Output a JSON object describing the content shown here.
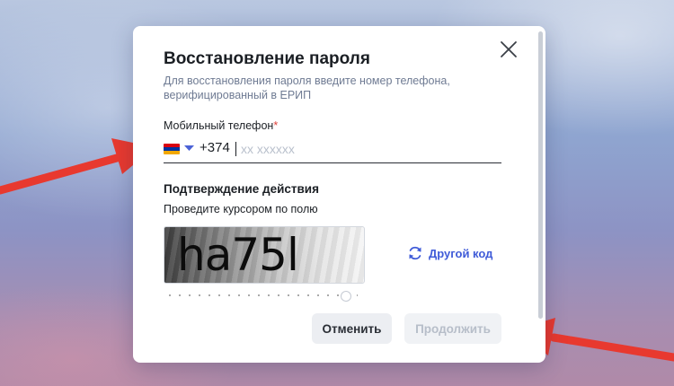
{
  "dialog": {
    "title": "Восстановление пароля",
    "subtitle": "Для восстановления пароля введите номер телефона, верифицированный в ЕРИП"
  },
  "phone": {
    "label": "Мобильный телефон",
    "required_mark": "*",
    "country_flag": "armenia-flag",
    "dial_code": "+374",
    "value": "",
    "placeholder": "xx xxxxxx"
  },
  "confirmation": {
    "title": "Подтверждение действия",
    "hint": "Проведите курсором по полю",
    "captcha_text": "ha75l",
    "other_code_label": "Другой код",
    "other_code_icon": "refresh-icon"
  },
  "buttons": {
    "cancel": "Отменить",
    "continue": "Продолжить"
  },
  "colors": {
    "accent": "#3f5bd8",
    "annotation_arrow": "#e8392f",
    "required": "#e0423b"
  }
}
